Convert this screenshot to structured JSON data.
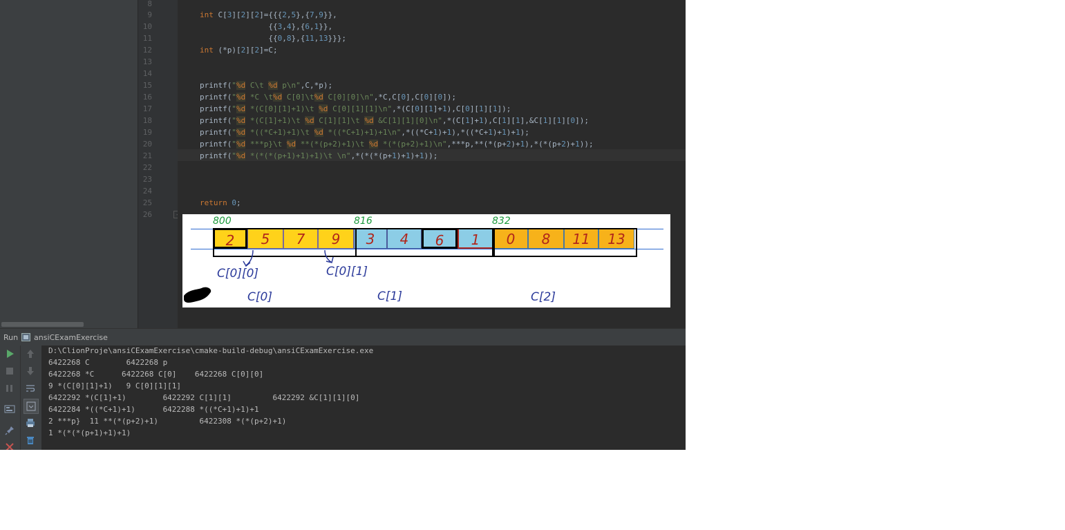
{
  "line_numbers": [
    "8",
    "9",
    "10",
    "11",
    "12",
    "13",
    "14",
    "15",
    "16",
    "17",
    "18",
    "19",
    "20",
    "21",
    "22",
    "23",
    "24",
    "25",
    "26"
  ],
  "code_lines": [
    {
      "n": "9",
      "text": "int C[3][2][2]={{{2,5},{7,9}},"
    },
    {
      "n": "10",
      "text": "               {{3,4},{6,1}},"
    },
    {
      "n": "11",
      "text": "               {{0,8},{11,13}}};"
    },
    {
      "n": "12",
      "text": "int (*p)[2][2]=C;"
    },
    {
      "n": "15",
      "text": "printf(\"%d C\\t %d p\\n\",C,*p);"
    },
    {
      "n": "16",
      "text": "printf(\"%d *C \\t%d C[0]\\t%d C[0][0]\\n\",*C,C[0],C[0][0]);"
    },
    {
      "n": "17",
      "text": "printf(\"%d *(C[0][1]+1)\\t %d C[0][1][1]\\n\",*(C[0][1]+1),C[0][1][1]);"
    },
    {
      "n": "18",
      "text": "printf(\"%d *(C[1]+1)\\t %d C[1][1]\\t %d &C[1][1][0]\\n\",*(C[1]+1),C[1][1],&C[1][1][0]);"
    },
    {
      "n": "19",
      "text": "printf(\"%d *((*C+1)+1)\\t %d *((*C+1)+1)+1\\n\",*((*C+1)+1),*((*C+1)+1)+1);"
    },
    {
      "n": "20",
      "text": "printf(\"%d ***p}\\t %d **(*(p+2)+1)\\t %d *(*(p+2)+1)\\n\",***p,**(*(p+2)+1),*(*(p+2)+1));"
    },
    {
      "n": "21",
      "text": "printf(\"%d *(*(*(p+1)+1)+1)\\t \\n\",*(*(*(p+1)+1)+1));"
    },
    {
      "n": "25",
      "text": "return 0;"
    }
  ],
  "diagram": {
    "addresses": [
      "800",
      "816",
      "832"
    ],
    "cells": [
      "2",
      "5",
      "7",
      "9",
      "3",
      "4",
      "6",
      "1",
      "0",
      "8",
      "11",
      "13"
    ],
    "labels": {
      "c00": "C[0][0]",
      "c01": "C[0][1]",
      "c0": "C[0]",
      "c1": "C[1]",
      "c2": "C[2]"
    },
    "colors": {
      "yellow": "#ffd21a",
      "blue": "#8ccde6",
      "orange": "#f7b21a"
    }
  },
  "run": {
    "tab_label": "Run",
    "config_name": "ansiCExamExercise",
    "console": [
      "D:\\ClionProje\\ansiCExamExercise\\cmake-build-debug\\ansiCExamExercise.exe",
      "6422268 C        6422268 p",
      "6422268 *C      6422268 C[0]    6422268 C[0][0]",
      "9 *(C[0][1]+1)   9 C[0][1][1]",
      "6422292 *(C[1]+1)        6422292 C[1][1]         6422292 &C[1][1][0]",
      "6422284 *((*C+1)+1)      6422288 *((*C+1)+1)+1",
      "2 ***p}  11 **(*(p+2)+1)         6422308 *(*(p+2)+1)",
      "1 *(*(*(p+1)+1)+1)"
    ]
  },
  "icons": [
    "run-icon",
    "stop-icon",
    "pause-icon",
    "scroll-up-icon",
    "scroll-down-icon",
    "soft-wrap-icon",
    "layout-icon",
    "print-icon",
    "trash-icon",
    "pin-icon",
    "close-icon",
    "cmake-icon"
  ]
}
